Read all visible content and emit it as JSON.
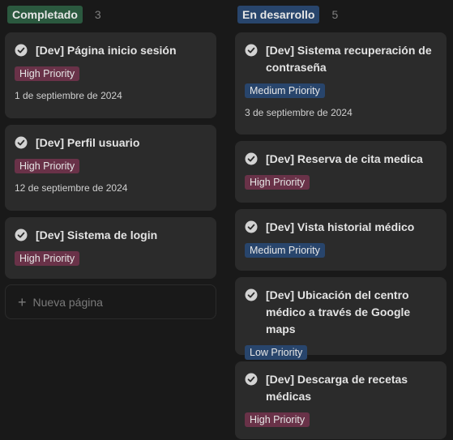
{
  "colors": {
    "background": "#191919",
    "card": "#2b2b2b",
    "status_completed": "#2b593f",
    "status_in_progress": "#28456c",
    "tag_high": "#693248",
    "tag_medium": "#28456c",
    "tag_low": "#28456c"
  },
  "columns": [
    {
      "label": "Completado",
      "count": "3",
      "cards": [
        {
          "title": "[Dev] Página inicio sesión",
          "tag": "High Priority",
          "date": "1 de septiembre de 2024",
          "icon": "check-circle-icon"
        },
        {
          "title": "[Dev] Perfil usuario",
          "tag": "High Priority",
          "date": "12 de septiembre de 2024",
          "icon": "check-circle-icon"
        },
        {
          "title": "[Dev] Sistema de login",
          "tag": "High Priority",
          "icon": "check-circle-icon"
        }
      ],
      "new_page_label": "Nueva página",
      "new_page_icon": "plus-icon"
    },
    {
      "label": "En desarrollo",
      "count": "5",
      "cards": [
        {
          "title": "[Dev] Sistema recuperación de contraseña",
          "tag": "Medium Priority",
          "date": "3 de septiembre de 2024",
          "icon": "check-circle-icon"
        },
        {
          "title": "[Dev] Reserva de cita medica",
          "tag": "High Priority",
          "icon": "check-circle-icon"
        },
        {
          "title": "[Dev] Vista historial médico",
          "tag": "Medium Priority",
          "icon": "check-circle-icon"
        },
        {
          "title": "[Dev] Ubicación del centro médico a través de Google maps",
          "tag": "Low Priority",
          "icon": "check-circle-icon"
        },
        {
          "title": "[Dev] Descarga de recetas médicas",
          "tag": "High Priority",
          "icon": "check-circle-icon"
        }
      ]
    }
  ]
}
